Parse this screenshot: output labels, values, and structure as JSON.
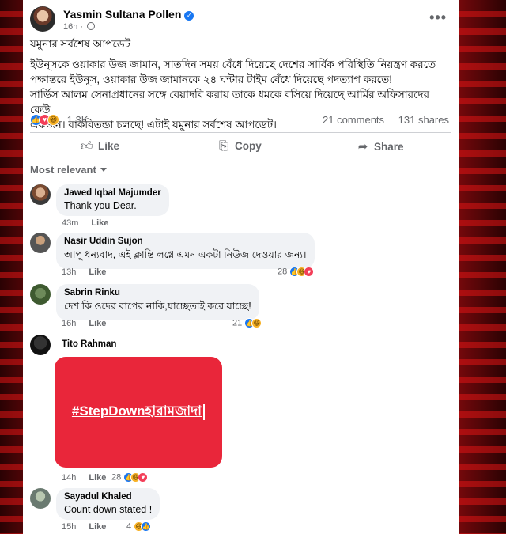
{
  "post": {
    "author": "Yasmin Sultana Pollen",
    "time": "16h",
    "separator": "·",
    "heading": "যমুনার সর্বশেষ আপডেট",
    "body_lines": [
      "ইউনূসকে ওয়াকার উজ জামান, সাতদিন সময় বেঁধে দিয়েছে দেশের সার্বিক পরিস্থিতি নিয়ন্ত্রণ করতে",
      "পক্ষান্তরে  ইউনূস, ওয়াকার উজ জামানকে ২৪ ঘন্টার টাইম বেঁধে দিয়েছে পদত্যাগ করতে!",
      "সার্ভিস আলম সেনাপ্রধানের সঙ্গে বেয়াদবি করায় তাকে ধমকে বসিয়ে দিয়েছে আর্মির অফিসারদের কেউ",
      "একজন। বাকবিতন্ডা চলছে! এটাই যমুনার সর্বশেষ আপডেট।"
    ],
    "reaction_count": "1.3K",
    "comments_count": "21 comments",
    "shares_count": "131 shares"
  },
  "actions": {
    "like": "Like",
    "copy": "Copy",
    "share": "Share"
  },
  "sort_label": "Most relevant",
  "comments": [
    {
      "name": "Jawed Iqbal Majumder",
      "text": "Thank you Dear.",
      "time": "43m",
      "like": "Like",
      "reactions": ""
    },
    {
      "name": "Nasir Uddin Sujon",
      "text": "আপু ধন্যবাদ, এই ক্লান্তি লগ্নে এমন একটা নিউজ দেওয়ার জন্য।",
      "time": "13h",
      "like": "Like",
      "reactions": "28"
    },
    {
      "name": "Sabrin Rinku",
      "text": "দেশ কি ওদের বাপের নাকি,যাচ্ছেতাই করে যাচ্ছে!",
      "time": "16h",
      "like": "Like",
      "reactions": "21"
    },
    {
      "name": "Tito Rahman",
      "text": "",
      "time": "14h",
      "like": "Like",
      "reactions": "28",
      "sticker_text": "#StepDownহারামজাদা"
    },
    {
      "name": "Sayadul Khaled",
      "text": "Count down stated !",
      "time": "15h",
      "like": "Like",
      "reactions": "4"
    }
  ],
  "icons": {
    "verified": "verified-badge-icon",
    "globe": "globe-icon",
    "more": "more-options-icon",
    "like": "thumbs-up-icon",
    "copy": "copy-link-icon",
    "share": "share-arrow-icon"
  },
  "colors": {
    "facebook_blue": "#1877f2",
    "love_red": "#f33e58",
    "haha_yellow": "#f7b125",
    "sticker_red": "#e9263a",
    "bubble_gray": "#f0f2f5"
  }
}
